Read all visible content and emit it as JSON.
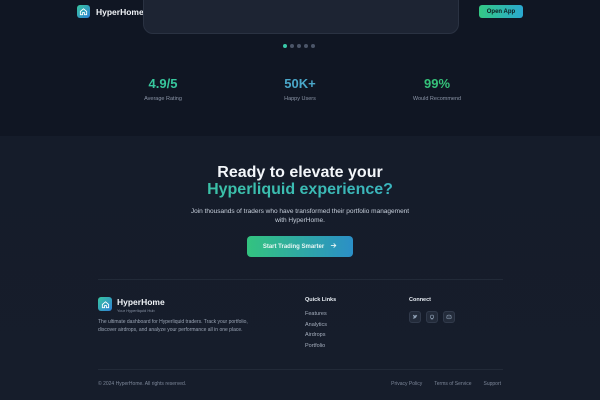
{
  "header": {
    "brand": "HyperHome",
    "open_app_label": "Open App"
  },
  "carousel": {
    "dot_count": 5,
    "active_index": 0
  },
  "stats": [
    {
      "value": "4.9/5",
      "label": "Average Rating"
    },
    {
      "value": "50K+",
      "label": "Happy Users"
    },
    {
      "value": "99%",
      "label": "Would Recommend"
    }
  ],
  "cta": {
    "title_line1": "Ready to elevate your",
    "title_line2": "Hyperliquid experience?",
    "subtitle": "Join thousands of traders who have transformed their portfolio management with HyperHome.",
    "button_label": "Start Trading Smarter",
    "button_icon": "arrow-right-icon"
  },
  "footer": {
    "brand": "HyperHome",
    "tagline": "Your Hyperliquid Hub",
    "description": "The ultimate dashboard for Hyperliquid traders. Track your portfolio, discover airdrops, and analyze your performance all in one place.",
    "quick_links_title": "Quick Links",
    "quick_links": [
      "Features",
      "Analytics",
      "Airdrops",
      "Portfolio"
    ],
    "connect_title": "Connect",
    "socials": [
      "twitter-icon",
      "github-icon",
      "discord-icon"
    ],
    "copyright": "© 2024 HyperHome. All rights reserved.",
    "legal_links": [
      "Privacy Policy",
      "Terms of Service",
      "Support"
    ]
  },
  "colors": {
    "accent_green": "#37c79d",
    "accent_blue": "#3aa8d8",
    "background": "#141a27"
  }
}
